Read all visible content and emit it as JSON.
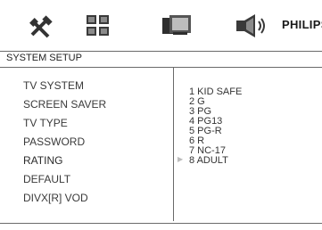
{
  "top_icons": [
    "tools-icon",
    "grid-icon",
    "display-icon",
    "speaker-icon"
  ],
  "brand": "PHILIPS",
  "header": {
    "title": "SYSTEM SETUP"
  },
  "menu": {
    "items": [
      "TV SYSTEM",
      "SCREEN SAVER",
      "TV TYPE",
      "PASSWORD",
      "RATING",
      "DEFAULT",
      "DIVX[R] VOD"
    ],
    "selected": "RATING"
  },
  "options": [
    "1 KID SAFE",
    "2 G",
    "3 PG",
    "4 PG13",
    "5 PG-R",
    "6 R",
    "7 NC-17",
    "8 ADULT"
  ]
}
